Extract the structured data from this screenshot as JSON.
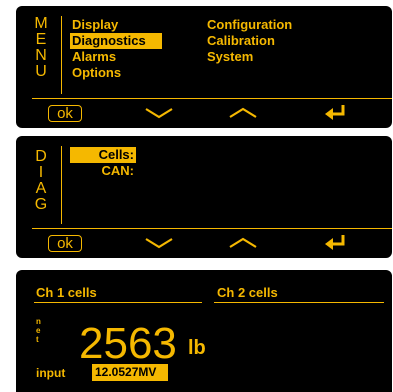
{
  "menu_screen": {
    "side_word": [
      "M",
      "E",
      "N",
      "U"
    ],
    "items_col1": [
      "Display",
      "Diagnostics",
      "Alarms",
      "Options"
    ],
    "items_col2": [
      "Configuration",
      "Calibration",
      "System"
    ],
    "selected_item": "Diagnostics"
  },
  "diag_screen": {
    "side_word": [
      "D",
      "I",
      "A",
      "G"
    ],
    "items": [
      "Cells:",
      "CAN:"
    ],
    "selected_item": "Cells:"
  },
  "softkeys": {
    "ok_label": "ok",
    "down_icon": "chevron-down-icon",
    "up_icon": "chevron-up-icon",
    "enter_icon": "enter-arrow-icon"
  },
  "cells_screen": {
    "ch1_title": "Ch 1 cells",
    "ch2_title": "Ch 2 cells",
    "net_label": [
      "n",
      "e",
      "t"
    ],
    "value": "2563",
    "unit": "lb",
    "input_label": "input",
    "input_value": "12.0527MV"
  },
  "colors": {
    "background": "#000000",
    "accent": "#f5b800",
    "page": "#ffffff"
  }
}
